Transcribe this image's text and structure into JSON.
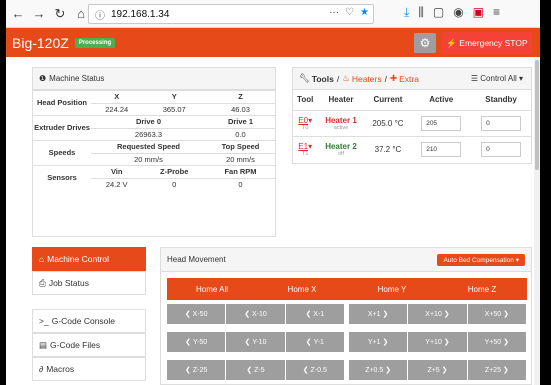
{
  "browser": {
    "url": "192.168.1.34",
    "icons": [
      "back-icon",
      "forward-icon",
      "reload-icon",
      "home-icon"
    ]
  },
  "header": {
    "title": "Big-120Z",
    "status": "Processing",
    "estop_label": "⚡ Emergency STOP"
  },
  "machine_status": {
    "title": "Machine Status",
    "position_label": "Head Position",
    "axes": [
      "X",
      "Y",
      "Z"
    ],
    "positions": [
      "224.24",
      "365.07",
      "46.03"
    ],
    "extruder_label": "Extruder Drives",
    "drives": [
      "Drive 0",
      "Drive 1"
    ],
    "drive_values": [
      "26963.3",
      "0.0"
    ],
    "speeds_label": "Speeds",
    "speed_headers": [
      "Requested Speed",
      "Top Speed"
    ],
    "speed_values": [
      "20 mm/s",
      "20 mm/s"
    ],
    "sensors_label": "Sensors",
    "sensor_headers": [
      "Vin",
      "Z-Probe",
      "Fan RPM"
    ],
    "sensor_values": [
      "24.2 V",
      "0",
      "0"
    ]
  },
  "tools": {
    "title": "Tools",
    "sep": "/",
    "heaters": "Heaters",
    "extra": "Extra",
    "control_all": "Control All",
    "columns": [
      "Tool",
      "Heater",
      "Current",
      "Active",
      "Standby"
    ],
    "rows": [
      {
        "tool": "E0",
        "sub": "T0",
        "heater": "Heater 1",
        "state": "active",
        "current": "205.0 °C",
        "active": "205",
        "standby": "0"
      },
      {
        "tool": "E1",
        "sub": "T1",
        "heater": "Heater 2",
        "state": "off",
        "current": "37.2 °C",
        "active": "210",
        "standby": "0"
      }
    ]
  },
  "nav": {
    "items": [
      "Machine Control",
      "Job Status",
      "G-Code Console",
      "G-Code Files",
      "Macros"
    ]
  },
  "head_movement": {
    "title": "Head Movement",
    "abc": "Auto Bed Compensation",
    "home": [
      "Home All",
      "Home X",
      "Home Y",
      "Home Z"
    ],
    "jog_x": [
      "X-50",
      "X-10",
      "X-1",
      "X+1",
      "X+10",
      "X+50"
    ],
    "jog_y": [
      "Y-50",
      "Y-10",
      "Y-1",
      "Y+1",
      "Y+10",
      "Y+50"
    ],
    "jog_z": [
      "Z-25",
      "Z-5",
      "Z-0.5",
      "Z+0.5",
      "Z+5",
      "Z+25"
    ]
  }
}
